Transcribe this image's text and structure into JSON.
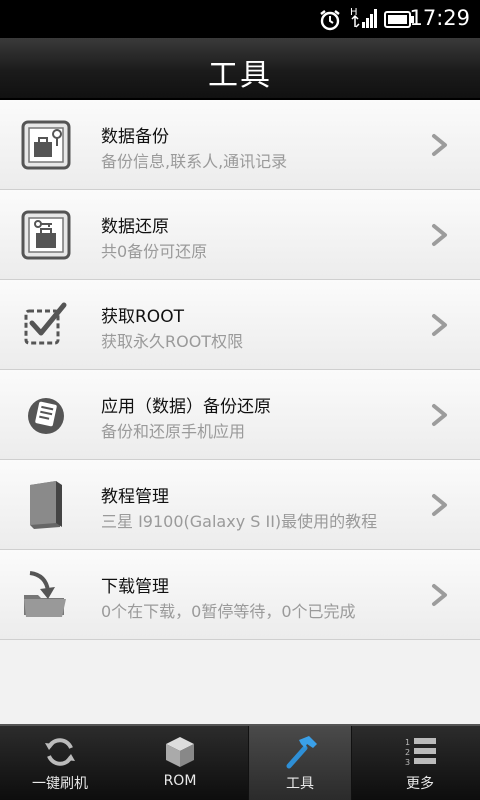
{
  "status_bar": {
    "time": "17:29",
    "icons": [
      "alarm-icon",
      "signal-icon",
      "battery-icon"
    ]
  },
  "header": {
    "title": "工具"
  },
  "list": {
    "items": [
      {
        "icon": "backup-icon",
        "label": "数据备份",
        "subtitle": "备份信息,联系人,通讯记录"
      },
      {
        "icon": "restore-icon",
        "label": "数据还原",
        "subtitle": "共0备份可还原"
      },
      {
        "icon": "checkbox-icon",
        "label": "获取ROOT",
        "subtitle": "获取永久ROOT权限"
      },
      {
        "icon": "app-backup-icon",
        "label": "应用（数据）备份还原",
        "subtitle": "备份和还原手机应用"
      },
      {
        "icon": "book-icon",
        "label": "教程管理",
        "subtitle": "三星 I9100(Galaxy S II)最使用的教程"
      },
      {
        "icon": "download-icon",
        "label": "下载管理",
        "subtitle": "0个在下载，0暂停等待，0个已完成"
      }
    ]
  },
  "tab_bar": {
    "tabs": [
      {
        "icon": "refresh-icon",
        "label": "一键刷机"
      },
      {
        "icon": "cube-icon",
        "label": "ROM"
      },
      {
        "icon": "hammer-icon",
        "label": "工具"
      },
      {
        "icon": "list-icon",
        "label": "更多"
      }
    ],
    "active_index": 2
  }
}
